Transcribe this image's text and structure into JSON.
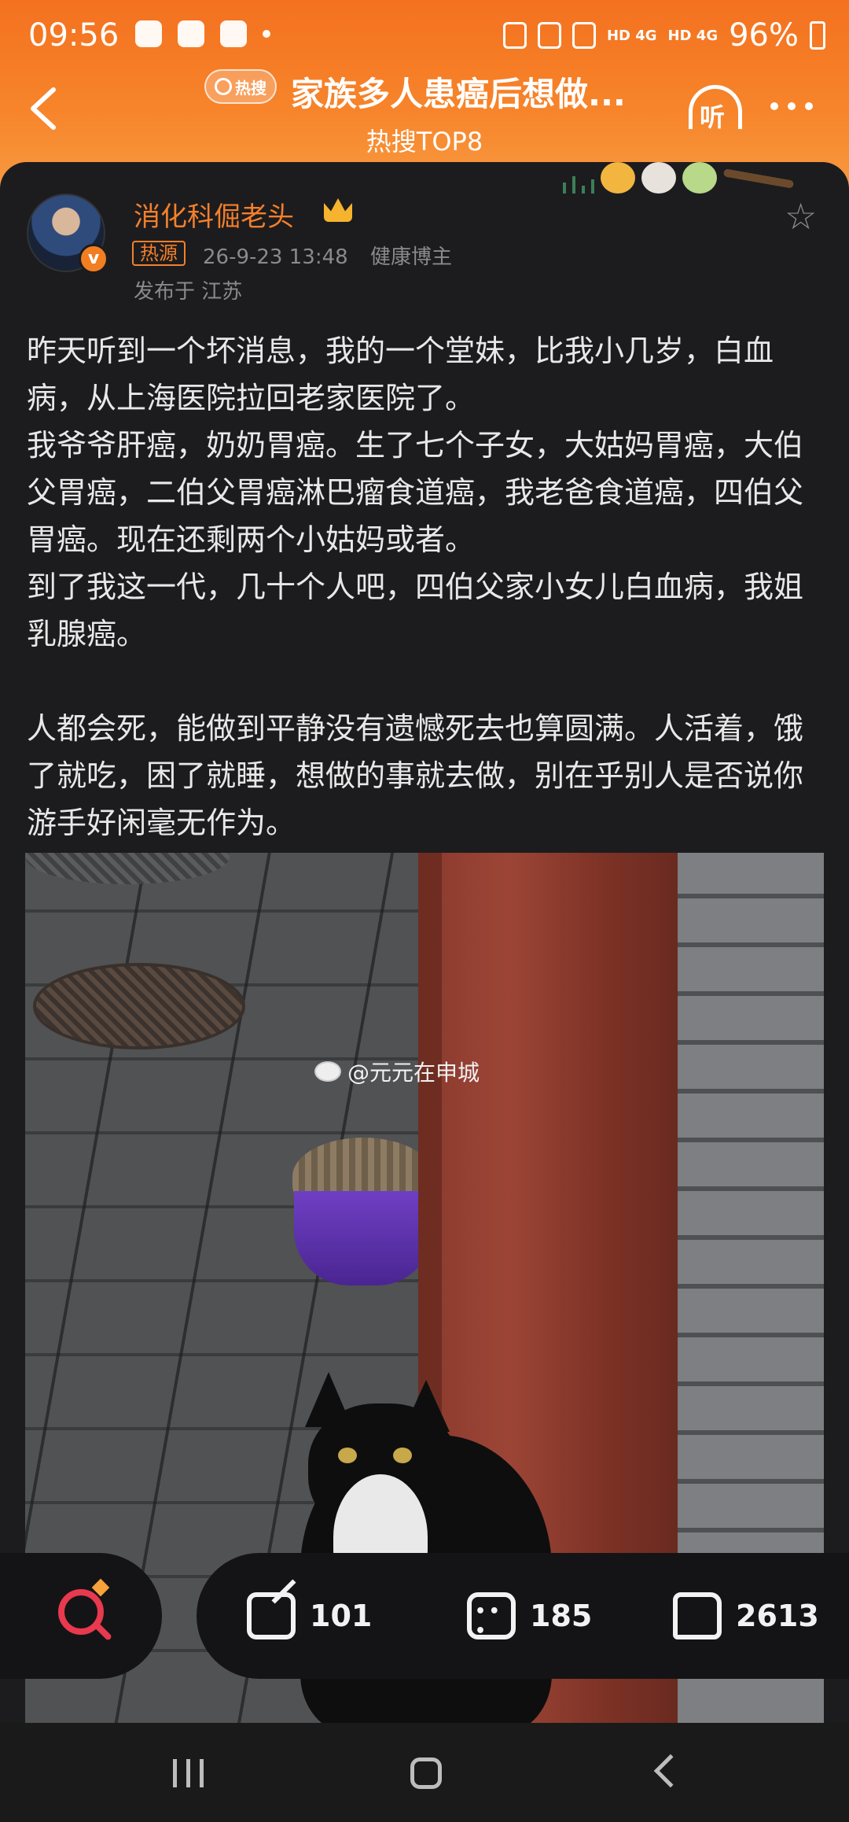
{
  "status_bar": {
    "time": "09:56",
    "battery": "96%",
    "network_1": "HD 4G",
    "network_2": "HD 4G"
  },
  "header": {
    "badge": "热搜",
    "title": "家族多人患癌后想做...",
    "subtitle": "热搜TOP8",
    "listen_label": "听"
  },
  "post": {
    "author": "消化科倔老头",
    "tag": "热源",
    "timestamp": "26-9-23 13:48",
    "source": "健康博主",
    "location": "发布于 江苏",
    "paragraphs": [
      "昨天听到一个坏消息，我的一个堂妹，比我小几岁，白血病，从上海医院拉回老家医院了。",
      "我爷爷肝癌，奶奶胃癌。生了七个子女，大姑妈胃癌，大伯父胃癌，二伯父胃癌淋巴瘤食道癌，我老爸食道癌，四伯父胃癌。现在还剩两个小姑妈或者。",
      "到了我这一代，几十个人吧，四伯父家小女儿白血病，我姐乳腺癌。",
      "人都会死，能做到平静没有遗憾死去也算圆满。人活着，饿了就吃，困了就睡，想做的事就去做，别在乎别人是否说你游手好闲毫无作为。"
    ],
    "image_watermark": "@元元在申城"
  },
  "actions": {
    "share_count": "101",
    "comment_count": "185",
    "like_count": "2613"
  },
  "colors": {
    "header_orange": "#f4711f",
    "author_orange": "#f47f2b",
    "background": "#1c1c1e"
  }
}
